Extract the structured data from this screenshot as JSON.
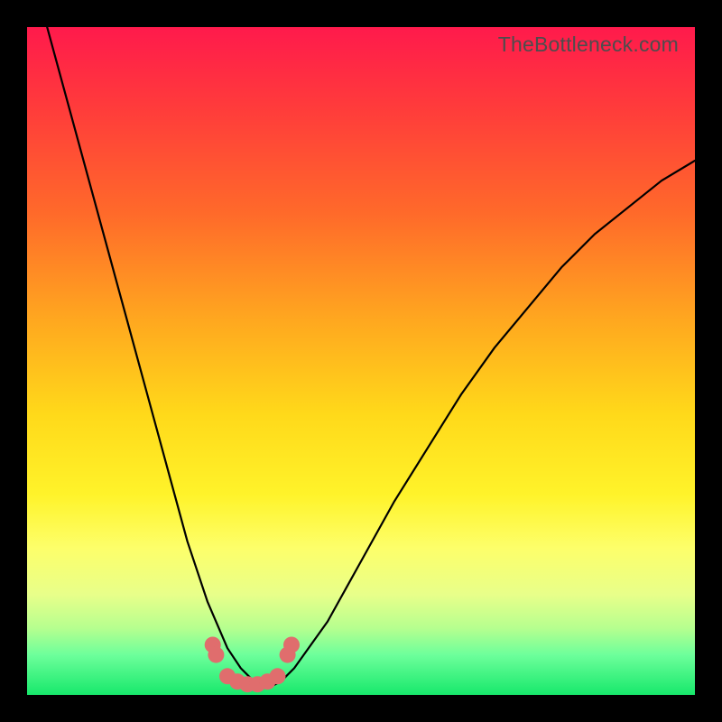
{
  "watermark": {
    "text": "TheBottleneck.com"
  },
  "colors": {
    "frame": "#000000",
    "curve": "#000000",
    "marker": "#e06d6d",
    "gradient_stops": [
      "#ff1a4c",
      "#ff3b3b",
      "#ff6a2a",
      "#ffa81f",
      "#ffd91a",
      "#fff32a",
      "#fdff6a",
      "#e8ff8a",
      "#b6ff8f",
      "#6dff9b",
      "#17e86b"
    ]
  },
  "chart_data": {
    "type": "line",
    "title": "",
    "xlabel": "",
    "ylabel": "",
    "xlim": [
      0,
      100
    ],
    "ylim": [
      0,
      100
    ],
    "grid": false,
    "legend": null,
    "series": [
      {
        "name": "bottleneck-curve",
        "x": [
          3,
          6,
          9,
          12,
          15,
          18,
          21,
          24,
          27,
          30,
          32,
          34,
          36,
          38,
          40,
          45,
          50,
          55,
          60,
          65,
          70,
          75,
          80,
          85,
          90,
          95,
          100
        ],
        "y": [
          100,
          89,
          78,
          67,
          56,
          45,
          34,
          23,
          14,
          7,
          4,
          2,
          1,
          2,
          4,
          11,
          20,
          29,
          37,
          45,
          52,
          58,
          64,
          69,
          73,
          77,
          80
        ]
      }
    ],
    "markers": {
      "name": "flat-region-markers",
      "x": [
        27.8,
        28.3,
        30.0,
        31.5,
        33.0,
        34.5,
        36.0,
        37.5,
        39.0,
        39.6
      ],
      "y": [
        7.5,
        6.0,
        2.8,
        2.0,
        1.6,
        1.6,
        2.0,
        2.8,
        6.0,
        7.5
      ]
    }
  }
}
